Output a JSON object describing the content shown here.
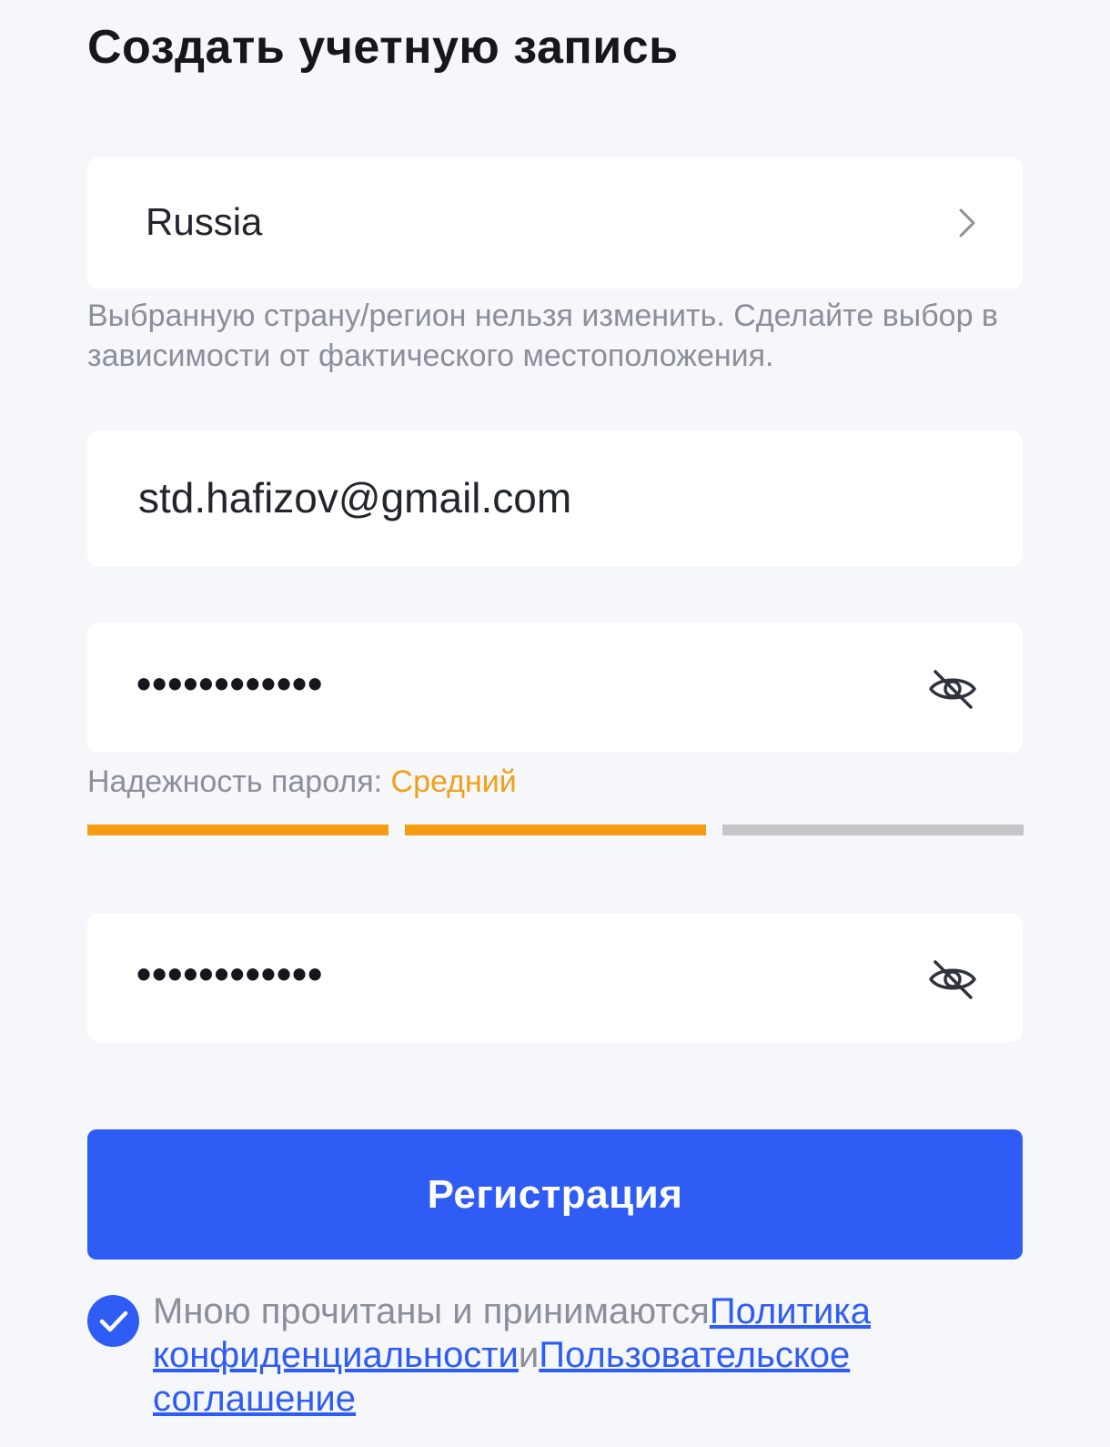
{
  "page": {
    "title": "Создать учетную запись"
  },
  "country": {
    "value": "Russia",
    "icon": "chevron-right-icon",
    "hint": "Выбранную страну/регион нельзя изменить. Сделайте выбор в зависимости от фактического местоположения."
  },
  "email": {
    "value": "std.hafizov@gmail.com"
  },
  "password": {
    "masked": "••••••••••••",
    "toggle_icon": "eye-off-icon",
    "strength_label": "Надежность пароля: ",
    "strength_value": "Средний",
    "strength_level": 2,
    "strength_segments": 3,
    "strength_color": "#f59d12",
    "strength_empty_color": "#c4c5c7"
  },
  "confirm_password": {
    "masked": "••••••••••••",
    "toggle_icon": "eye-off-icon"
  },
  "register_button": {
    "label": "Регистрация",
    "color": "#2f5cf5"
  },
  "agreement": {
    "checked": true,
    "prefix": "Мною прочитаны и принимаются",
    "privacy_link": "Политика конфиденциальности",
    "conjunction": "и",
    "terms_link": "Пользовательское соглашение"
  }
}
